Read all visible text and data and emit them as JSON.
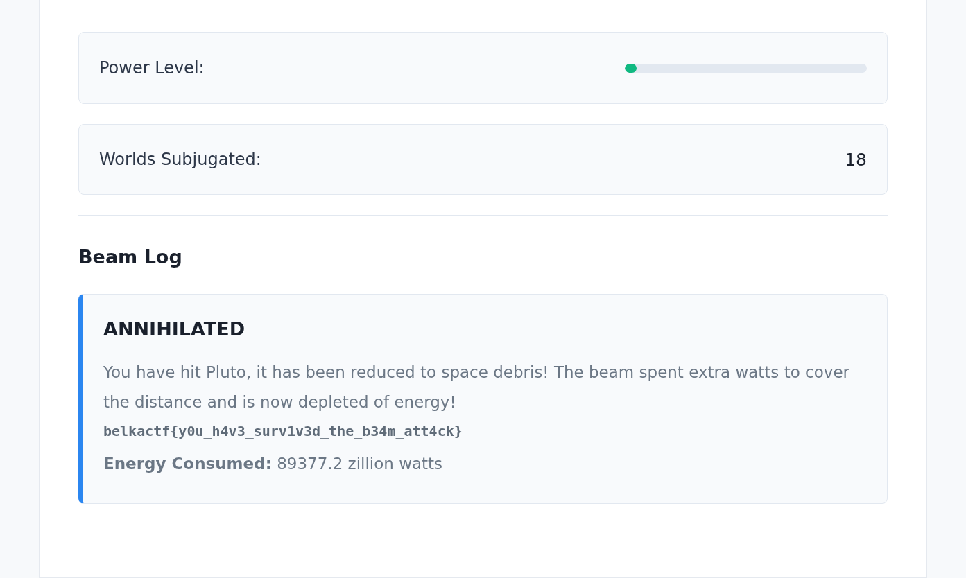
{
  "stats": [
    {
      "kind": "bar",
      "label": "Power Level:",
      "level": 0.05
    },
    {
      "kind": "value",
      "label": "Worlds Subjugated:",
      "value": "18"
    }
  ],
  "beam_log": {
    "heading": "Beam Log",
    "entries": [
      {
        "title": "ANNIHILATED",
        "message": "You have hit Pluto, it has been reduced to space debris! The beam spent extra watts to cover the distance and is now depleted of energy!",
        "flag": "belkactf{y0u_h4v3_surv1v3d_the_b34m_att4ck}",
        "energy": "**Energy Consumed:** 89377.2 zillion watts"
      }
    ]
  }
}
